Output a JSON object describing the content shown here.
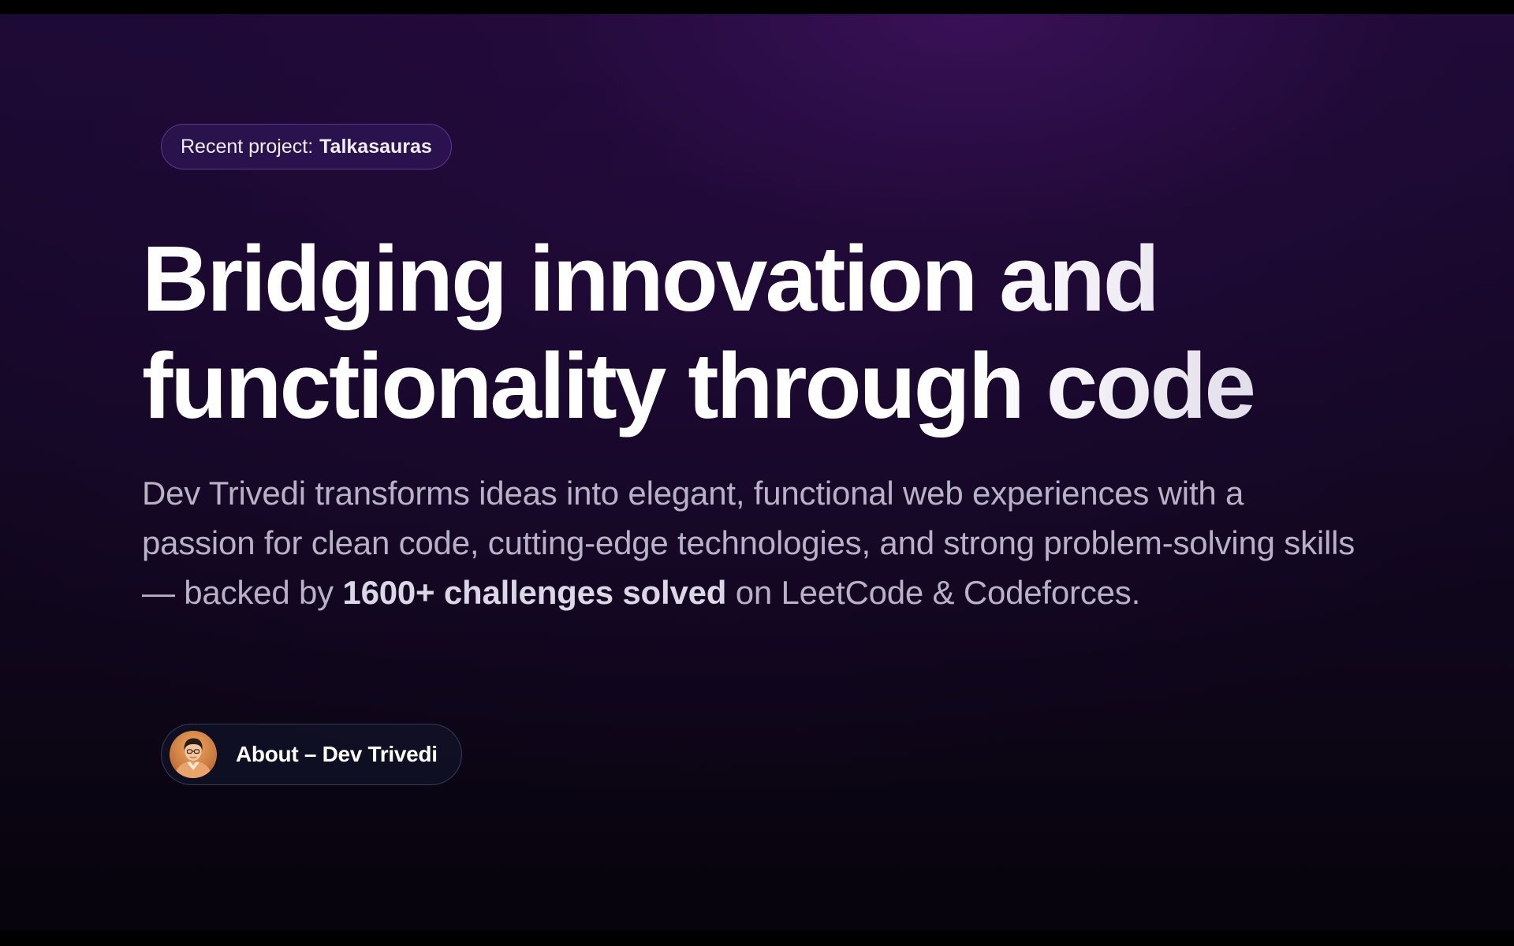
{
  "badge": {
    "prefix": "Recent project:",
    "project": "Talkasauras"
  },
  "headline": {
    "line1": "Bridging innovation and",
    "line2": "functionality through code"
  },
  "description": {
    "part1": "Dev Trivedi transforms ideas into elegant, functional web experiences with a passion for clean code, cutting-edge technologies, and strong problem-solving skills — backed by ",
    "highlight": "1600+ challenges solved",
    "part2": " on LeetCode & Codeforces."
  },
  "about_button": {
    "label": "About – Dev Trivedi",
    "avatar_icon": "person-avatar-icon"
  },
  "colors": {
    "background_top": "#1d0a34",
    "background_bottom": "#07040c",
    "badge_bg": "#2e1454",
    "button_bg": "#101026",
    "text_primary": "#ffffff",
    "text_muted": "#b8b1c8"
  }
}
